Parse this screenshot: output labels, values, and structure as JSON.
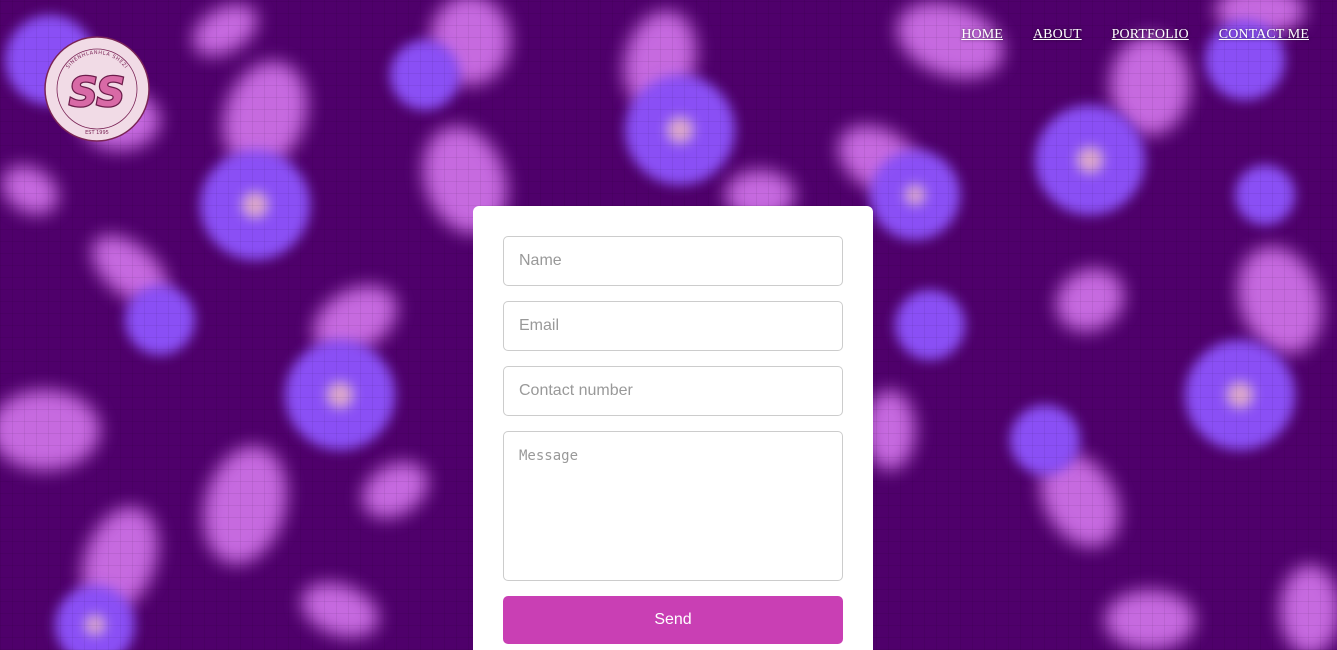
{
  "brand": {
    "logo_text": "SS",
    "logo_arc_text": "SINENHLANHLA SHEZI",
    "logo_est": "EST 1995"
  },
  "nav": {
    "items": [
      {
        "label": "HOME"
      },
      {
        "label": "ABOUT"
      },
      {
        "label": "PORTFOLIO"
      },
      {
        "label": "CONTACT ME"
      }
    ]
  },
  "form": {
    "name_placeholder": "Name",
    "email_placeholder": "Email",
    "contact_placeholder": "Contact number",
    "message_placeholder": "Message",
    "send_label": "Send"
  },
  "colors": {
    "background": "#4f006b",
    "petal": "#cd6fe6",
    "flower": "#8a4ff5",
    "flower_center": "#e8b3c4",
    "button": "#c93fb4",
    "logo_bg": "#f1dbe6",
    "logo_letters": "#9c2a6d"
  }
}
